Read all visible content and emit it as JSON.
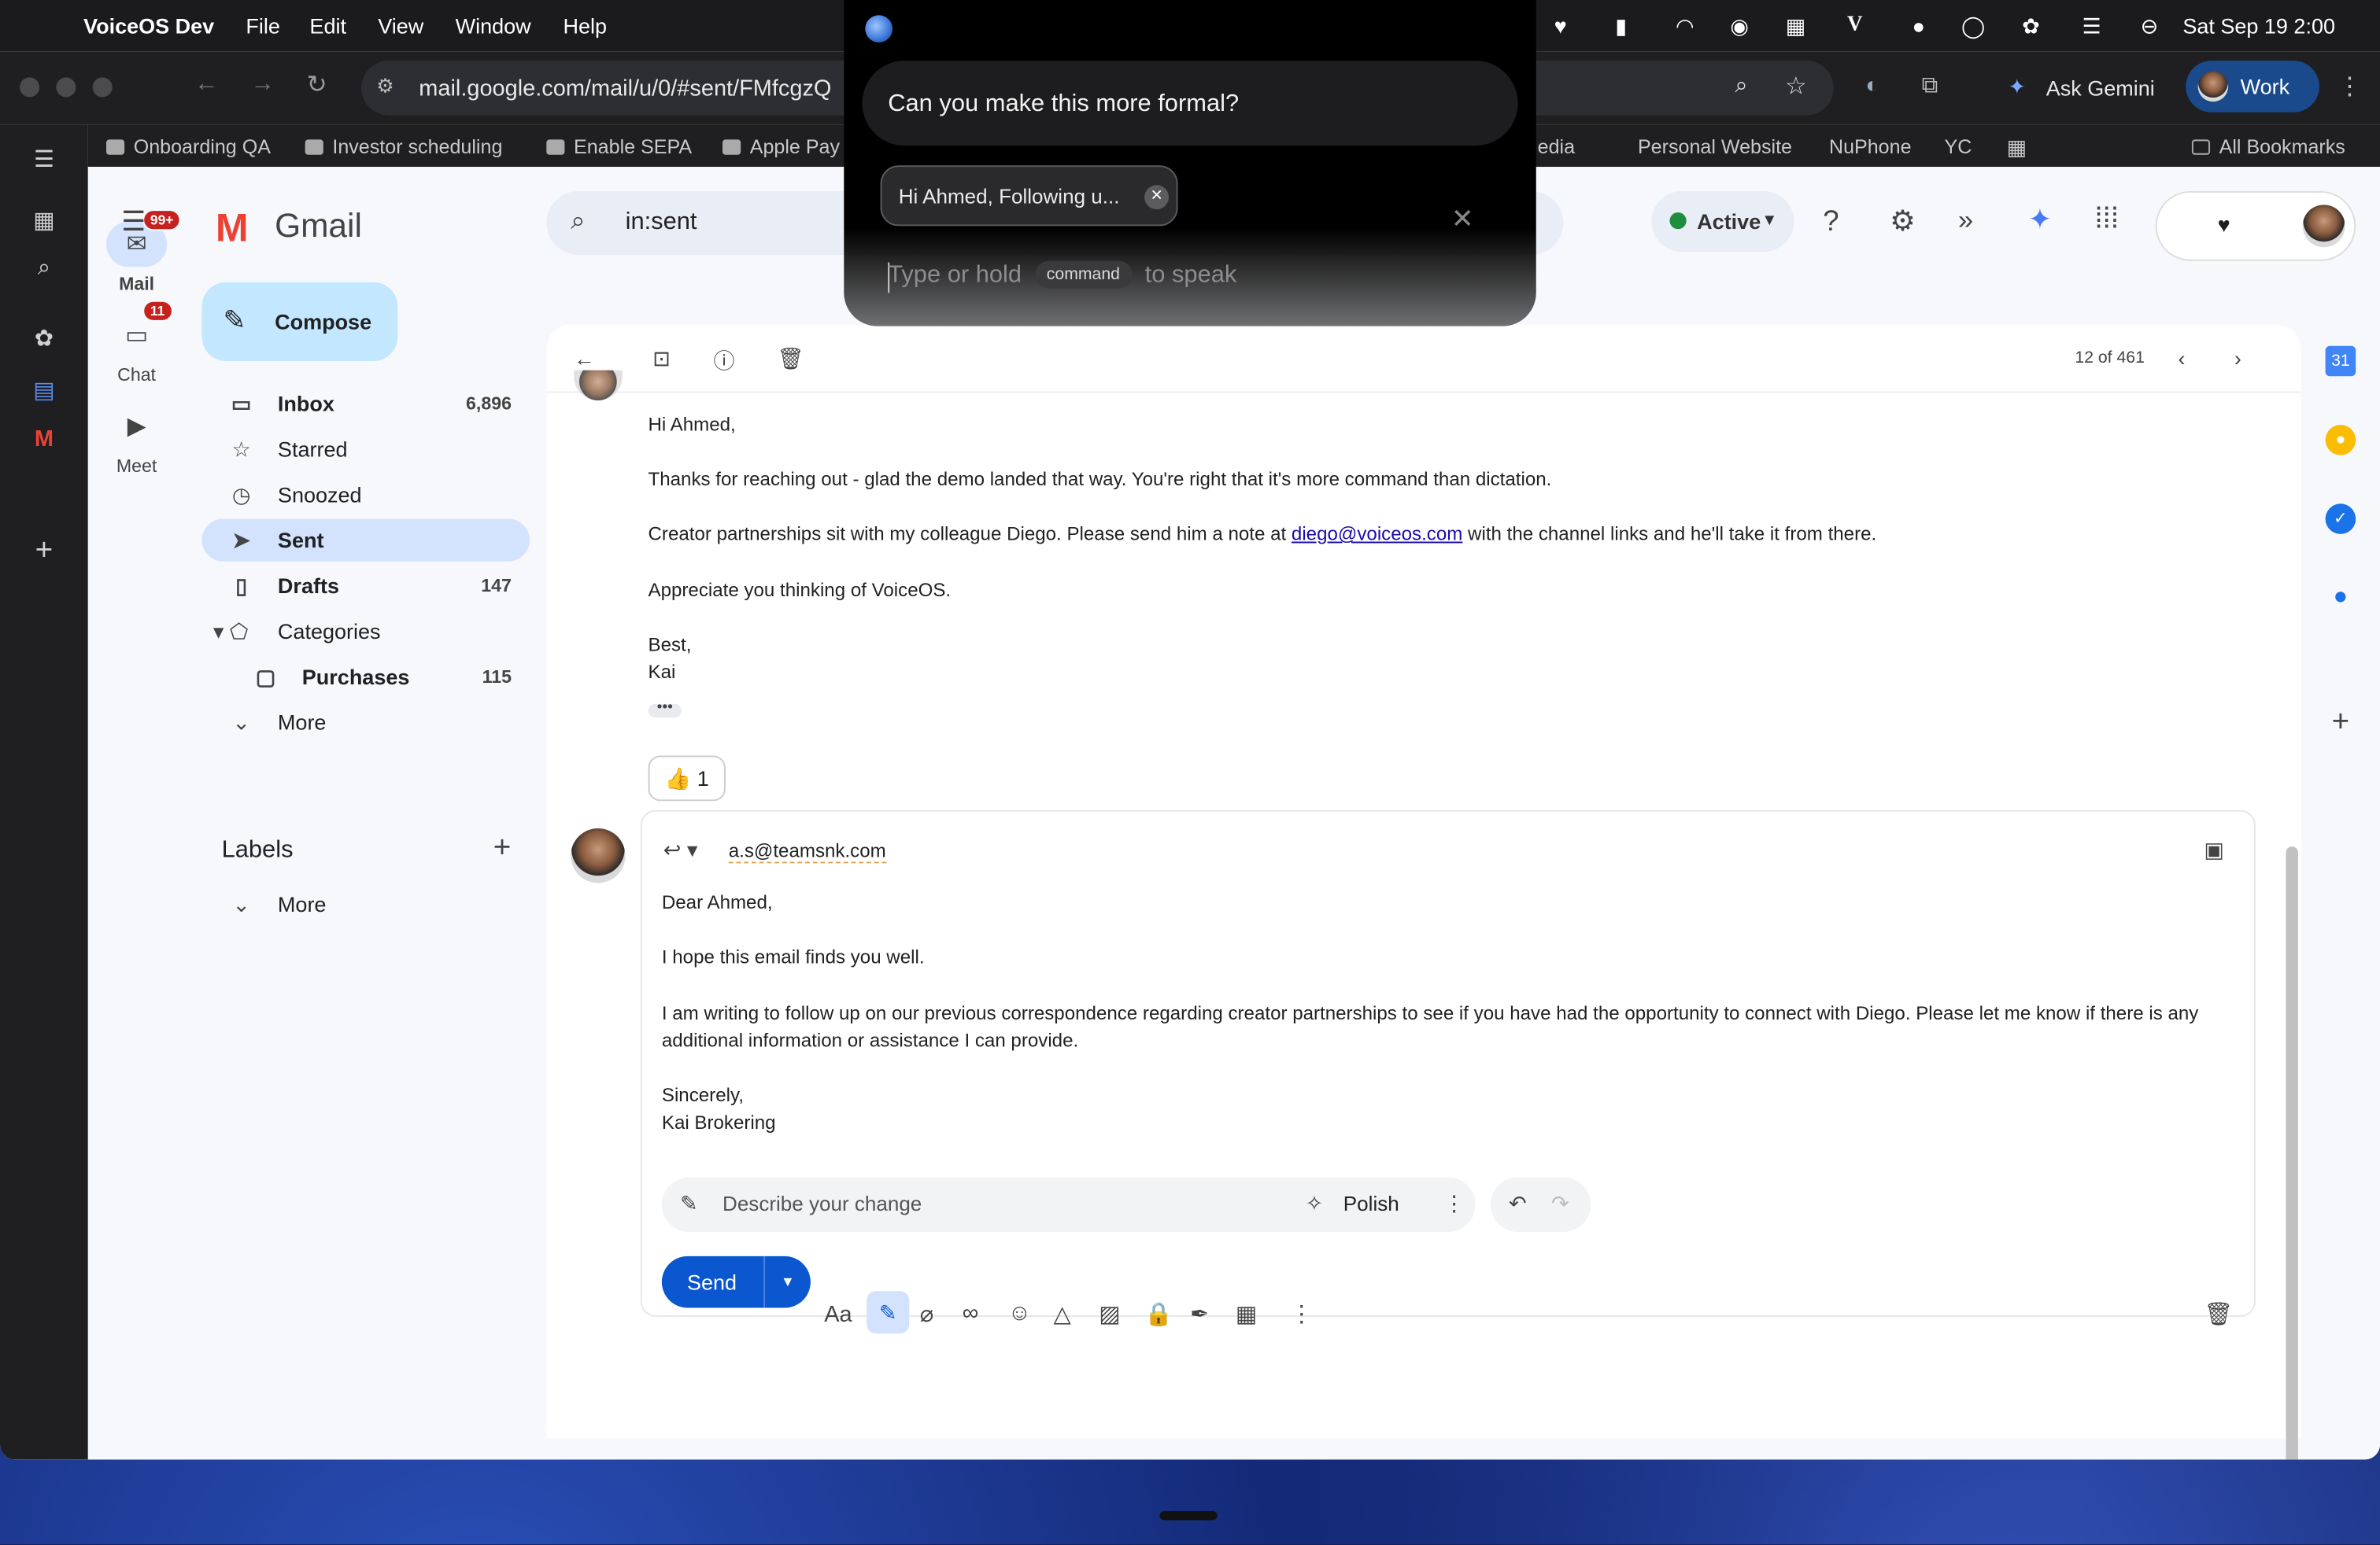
{
  "menubar": {
    "app": "VoiceOS Dev",
    "menus": [
      "File",
      "Edit",
      "View",
      "Window",
      "Help"
    ],
    "clock": "Sat Sep 19  2:00"
  },
  "browser": {
    "url": "mail.google.com/mail/u/0/#sent/FMfcgzQ",
    "ask_gemini": "Ask Gemini",
    "profile": "Work",
    "bookmarks": [
      "Onboarding QA",
      "Investor scheduling",
      "Enable SEPA",
      "Apple Pay",
      "edia",
      "Personal Website",
      "NuPhone",
      "YC"
    ],
    "all_bookmarks": "All Bookmarks"
  },
  "rail": {
    "mail": "Mail",
    "mail_badge": "99+",
    "chat": "Chat",
    "chat_badge": "11",
    "meet": "Meet"
  },
  "gmail": {
    "logo": "Gmail",
    "search": "in:sent",
    "status": "Active",
    "compose": "Compose",
    "nav": [
      {
        "label": "Inbox",
        "count": "6,896"
      },
      {
        "label": "Starred",
        "count": ""
      },
      {
        "label": "Snoozed",
        "count": ""
      },
      {
        "label": "Sent",
        "count": ""
      },
      {
        "label": "Drafts",
        "count": "147"
      },
      {
        "label": "Categories",
        "count": ""
      },
      {
        "label": "Purchases",
        "count": "115"
      },
      {
        "label": "More",
        "count": ""
      }
    ],
    "labels": {
      "title": "Labels",
      "more": "More"
    },
    "pager": "12 of 461"
  },
  "message": {
    "greeting": "Hi Ahmed,",
    "p1": "Thanks for reaching out - glad the demo landed that way. You're right that it's more command than dictation.",
    "p2a": "Creator partnerships sit with my colleague Diego. Please send him a note at ",
    "p2link": "diego@voiceos.com",
    "p2b": " with the channel links and he'll take it from there.",
    "p3": "Appreciate you thinking of VoiceOS.",
    "signoff": "Best,",
    "name": "Kai",
    "reaction": "👍 1"
  },
  "reply": {
    "to": "a.s@teamsnk.com",
    "greeting": "Dear Ahmed,",
    "p1": "I hope this email finds you well.",
    "p2a": "I am writing to follow up on our previous correspondence regarding creator partnerships to see if you have had the opportunity to connect with Diego. Please let me know if there is any",
    "p2b": "additional information or assistance I can provide.",
    "signoff": "Sincerely,",
    "name": "Kai Brokering",
    "describe_placeholder": "Describe your change",
    "polish": "Polish",
    "send": "Send"
  },
  "voice": {
    "prompt": "Can you make this more formal?",
    "chip": "Hi Ahmed, Following u...",
    "hint_a": "Type or hold",
    "hint_key": "command",
    "hint_b": "to speak"
  }
}
